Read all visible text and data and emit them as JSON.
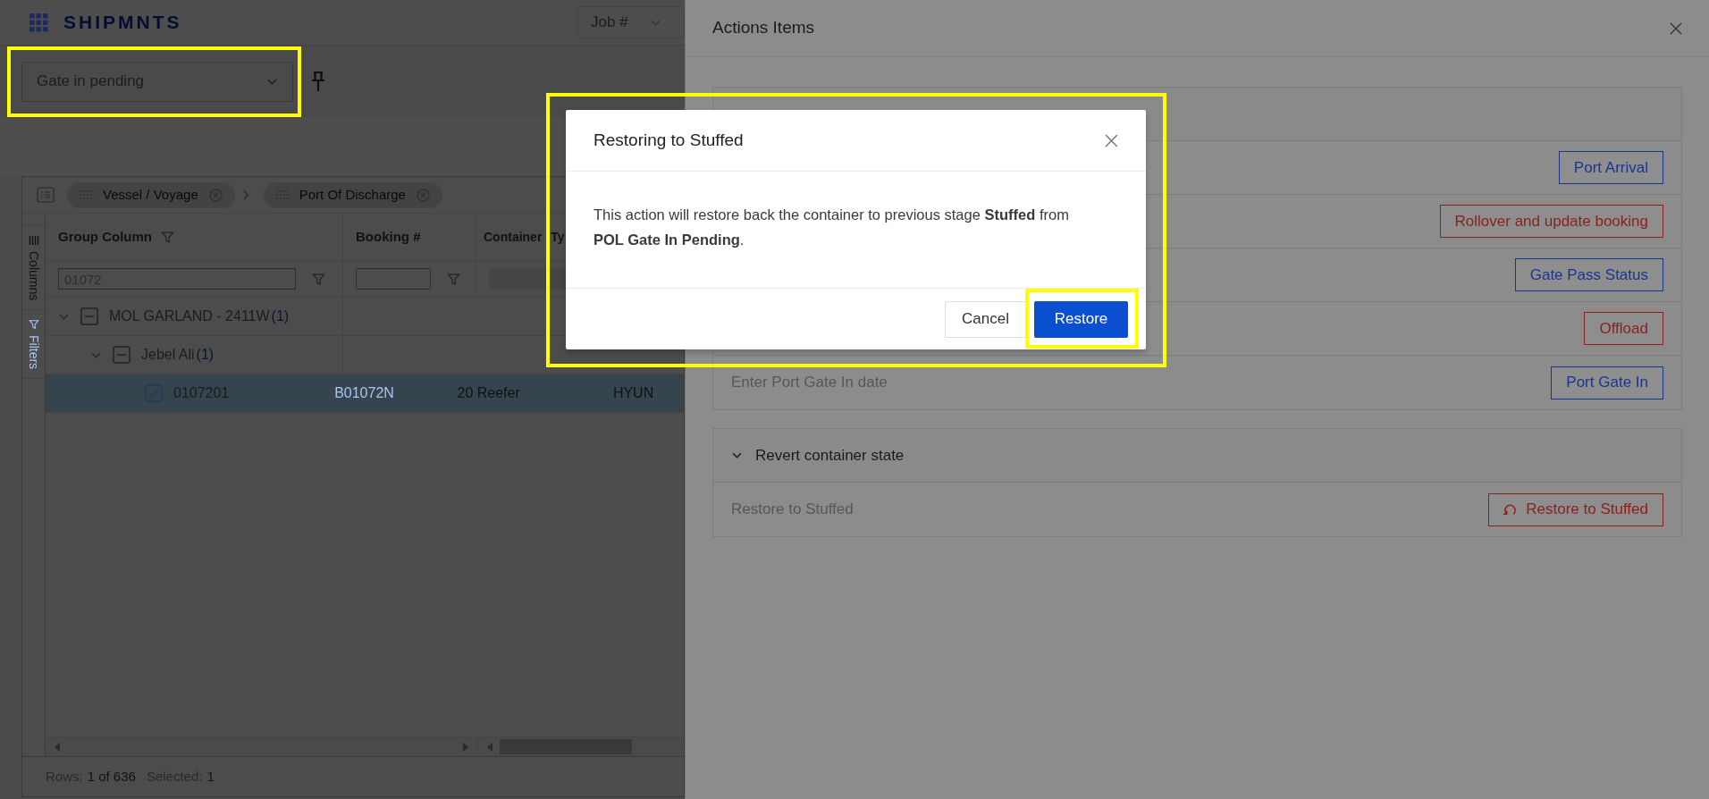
{
  "app": {
    "logo": "SHIPMNTS",
    "job_select": "Job #",
    "view_select": "Gate in pending"
  },
  "grid": {
    "group_chips": [
      "Vessel / Voyage",
      "Port Of Discharge"
    ],
    "side_tabs": [
      {
        "label": "Columns",
        "selected": false
      },
      {
        "label": "Filters",
        "selected": true
      }
    ],
    "columns": [
      {
        "label": "Group Column",
        "filter": "01072",
        "filter_disabled": false
      },
      {
        "label": "Booking #",
        "filter_disabled": false
      },
      {
        "label": "Container Ty",
        "filter_disabled": true
      }
    ],
    "rows": [
      {
        "label": "MOL GARLAND - 2411W",
        "count": "(1)",
        "expanded": true,
        "checked": false,
        "indeterminate": true,
        "children": [
          {
            "label": "Jebel Ali",
            "count": "(1)",
            "expanded": true,
            "checked": false,
            "indeterminate": true,
            "children": [
              {
                "label": "0107201",
                "checked": true,
                "selected": true,
                "cells": [
                  "B01072N",
                  "20 Reefer",
                  "HYUN"
                ]
              }
            ]
          }
        ]
      }
    ],
    "status": {
      "rows_label": "Rows:",
      "rows_value": "1 of 636",
      "selected_label": "Selected:",
      "selected_value": "1"
    }
  },
  "drawer": {
    "title": "Actions Items",
    "sections": [
      {
        "items": [
          {
            "button": "Port Arrival",
            "kind": "primary"
          },
          {
            "button": "Rollover and update booking",
            "kind": "danger"
          },
          {
            "button": "Gate Pass Status",
            "kind": "primary"
          },
          {
            "button": "Offload",
            "kind": "danger"
          },
          {
            "label": "Enter Port Gate In date",
            "button": "Port Gate In",
            "kind": "primary"
          }
        ]
      },
      {
        "title": "Revert container state",
        "expanded": true,
        "items": [
          {
            "label": "Restore to Stuffed",
            "button": "Restore to Stuffed",
            "kind": "revert"
          }
        ]
      }
    ]
  },
  "modal": {
    "title": "Restoring to Stuffed",
    "body": "This action will restore back the container to previous stage **Stuffed** from **POL Gate In Pending**.",
    "buttons": [
      {
        "label": "Cancel",
        "kind": "secondary"
      },
      {
        "label": "Restore",
        "kind": "primary"
      }
    ]
  }
}
